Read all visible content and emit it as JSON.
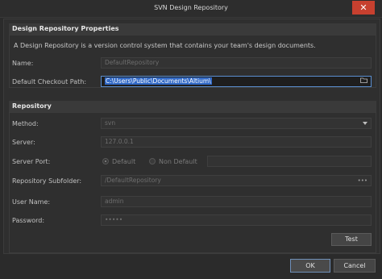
{
  "window": {
    "title": "SVN Design Repository",
    "close_glyph": "✕"
  },
  "properties": {
    "header": "Design Repository Properties",
    "description": "A Design Repository is a version control system that contains your team's design documents.",
    "name_label": "Name:",
    "name_value": "DefaultRepository",
    "checkout_label": "Default Checkout Path:",
    "checkout_value": "C:\\Users\\Public\\Documents\\Altium\\",
    "checkout_icon": "folder-icon"
  },
  "repository": {
    "header": "Repository",
    "method_label": "Method:",
    "method_value": "svn",
    "server_label": "Server:",
    "server_value": "127.0.0.1",
    "port_label": "Server Port:",
    "port_default_label": "Default",
    "port_nondefault_label": "Non Default",
    "port_selected": "Default",
    "subfolder_label": "Repository Subfolder:",
    "subfolder_value": "/DefaultRepository",
    "subfolder_browse": "•••",
    "username_label": "User Name:",
    "username_value": "admin",
    "password_label": "Password:",
    "password_value": "•••••",
    "test_button": "Test"
  },
  "footer": {
    "ok_button": "OK",
    "cancel_button": "Cancel"
  },
  "colors": {
    "background": "#2b2b2b",
    "selection": "#3169c6",
    "close_button": "#c7402f"
  }
}
